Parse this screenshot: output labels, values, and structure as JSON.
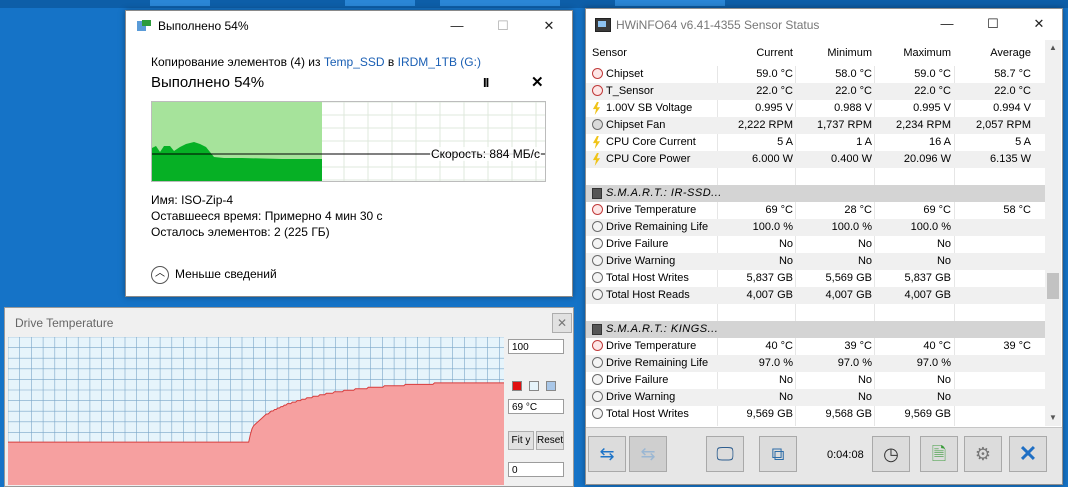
{
  "copy_dialog": {
    "title": "Выполнено 54%",
    "line_prefix": "Копирование элементов (4) из",
    "source": "Temp_SSD",
    "line_mid": "в",
    "target": "IRDM_1TB (G:)",
    "heading": "Выполнено 54%",
    "progress_percent": 54,
    "speed_label": "Скорость: 884 МБ/с",
    "name_label": "Имя:",
    "name_value": "ISO-Zip-4",
    "time_label": "Оставшееся время:",
    "time_value": "Примерно 4 мин 30 с",
    "items_label": "Осталось элементов:",
    "items_value": "2 (225 ГБ)",
    "less_details": "Меньше сведений",
    "minimize": "—",
    "maximize": "☐",
    "close": "✕",
    "pause": "II",
    "cancel": "✕",
    "colors": {
      "fill": "#06b025",
      "fill_light": "#a6e39b"
    }
  },
  "temp_graph": {
    "title": "Drive Temperature",
    "close": "✕",
    "max_value": "100",
    "current_value": "69 °C",
    "min_value": "0",
    "fit_y": "Fit y",
    "reset": "Reset",
    "colors": {
      "area": "#f6a0a0",
      "line": "#d83c3c",
      "grid": "#7aa6c8",
      "bg": "#e6f4fb",
      "swatch_red": "#e01010",
      "swatch_light": "#e6f4fb",
      "swatch_blue": "#a9c7e8"
    },
    "series_y": [
      29,
      29,
      29,
      29,
      29,
      29,
      29,
      29,
      29,
      29,
      29,
      29,
      29,
      29,
      29,
      29,
      29,
      29,
      29,
      29,
      29,
      29,
      29,
      29,
      29,
      29,
      29,
      29,
      29,
      29,
      29,
      29,
      29,
      29,
      29,
      29,
      29,
      29,
      29,
      29,
      29,
      29,
      29,
      29,
      29,
      29,
      29,
      29,
      29,
      29,
      29,
      29,
      29,
      29,
      29,
      29,
      29,
      29,
      29,
      29,
      29,
      29,
      29,
      29,
      29,
      29,
      29,
      29,
      29,
      29,
      29,
      29,
      29,
      29,
      29,
      29,
      29,
      29,
      29,
      29,
      29,
      29,
      29,
      29,
      29,
      29,
      29,
      29,
      29,
      29,
      29,
      29,
      29,
      29,
      29,
      29,
      29,
      29,
      29,
      29,
      29,
      29,
      29,
      29,
      29,
      29,
      29,
      29,
      29,
      29,
      29,
      29,
      29,
      29,
      29,
      29,
      29,
      29,
      29,
      29,
      29,
      29,
      29,
      29,
      29,
      29,
      29,
      29,
      29,
      29,
      29,
      29,
      29,
      29,
      29,
      29,
      29,
      29,
      29,
      29,
      29,
      29,
      29,
      29,
      29,
      29,
      29,
      29,
      29,
      29,
      34,
      38,
      40,
      41,
      42,
      43,
      44,
      45,
      46,
      47,
      48,
      48,
      49,
      50,
      50,
      51,
      51,
      52,
      52,
      53,
      53,
      54,
      54,
      55,
      55,
      55,
      56,
      56,
      56,
      57,
      57,
      57,
      58,
      58,
      58,
      59,
      59,
      59,
      59,
      60,
      60,
      60,
      60,
      61,
      61,
      61,
      61,
      62,
      62,
      62,
      62,
      62,
      63,
      63,
      63,
      63,
      63,
      63,
      64,
      64,
      64,
      64,
      64,
      64,
      64,
      65,
      65,
      65,
      65,
      65,
      65,
      65,
      65,
      66,
      66,
      66,
      66,
      66,
      66,
      66,
      66,
      66,
      66,
      67,
      67,
      67,
      67,
      67,
      67,
      67,
      67,
      67,
      67,
      67,
      67,
      67,
      68,
      68,
      68,
      68,
      68,
      68,
      68,
      68,
      68,
      68,
      68,
      68,
      68,
      68,
      68,
      68,
      68,
      68,
      69,
      69,
      69,
      69,
      69,
      69,
      69,
      69,
      69,
      69,
      69,
      69,
      69,
      69,
      69,
      69,
      69,
      69,
      69,
      69,
      69,
      69,
      69,
      69,
      69,
      69,
      69,
      69,
      69,
      69,
      69,
      69,
      69,
      69,
      69,
      69,
      69,
      69,
      69,
      69,
      69,
      69,
      69,
      69
    ]
  },
  "hwinfo": {
    "title": "HWiNFO64 v6.41-4355 Sensor Status",
    "minimize": "—",
    "maximize": "☐",
    "close": "✕",
    "headers": [
      "Sensor",
      "Current",
      "Minimum",
      "Maximum",
      "Average"
    ],
    "rows": [
      {
        "type": "row",
        "icon": "thermometer-icon",
        "name": "Chipset",
        "cur": "59.0 °C",
        "min": "58.0 °C",
        "max": "59.0 °C",
        "avg": "58.7 °C"
      },
      {
        "type": "row",
        "icon": "thermometer-icon",
        "name": "T_Sensor",
        "cur": "22.0 °C",
        "min": "22.0 °C",
        "max": "22.0 °C",
        "avg": "22.0 °C"
      },
      {
        "type": "row",
        "icon": "voltage-bolt-icon",
        "name": "1.00V SB Voltage",
        "cur": "0.995 V",
        "min": "0.988 V",
        "max": "0.995 V",
        "avg": "0.994 V"
      },
      {
        "type": "row",
        "icon": "fan-icon",
        "name": "Chipset Fan",
        "cur": "2,222 RPM",
        "min": "1,737 RPM",
        "max": "2,234 RPM",
        "avg": "2,057 RPM"
      },
      {
        "type": "row",
        "icon": "voltage-bolt-icon",
        "name": "CPU Core Current",
        "cur": "5 A",
        "min": "1 A",
        "max": "16 A",
        "avg": "5 A"
      },
      {
        "type": "row",
        "icon": "voltage-bolt-icon",
        "name": "CPU Core Power",
        "cur": "6.000 W",
        "min": "0.400 W",
        "max": "20.096 W",
        "avg": "6.135 W"
      },
      {
        "type": "blank"
      },
      {
        "type": "group",
        "icon": "drive-icon",
        "name": "S.M.A.R.T.: IR-SSD..."
      },
      {
        "type": "row",
        "icon": "thermometer-icon",
        "name": "Drive Temperature",
        "cur": "69 °C",
        "min": "28 °C",
        "max": "69 °C",
        "avg": "58 °C"
      },
      {
        "type": "row",
        "icon": "clock-icon",
        "name": "Drive Remaining Life",
        "cur": "100.0 %",
        "min": "100.0 %",
        "max": "100.0 %",
        "avg": ""
      },
      {
        "type": "row",
        "icon": "clock-icon",
        "name": "Drive Failure",
        "cur": "No",
        "min": "No",
        "max": "No",
        "avg": ""
      },
      {
        "type": "row",
        "icon": "clock-icon",
        "name": "Drive Warning",
        "cur": "No",
        "min": "No",
        "max": "No",
        "avg": ""
      },
      {
        "type": "row",
        "icon": "clock-icon",
        "name": "Total Host Writes",
        "cur": "5,837 GB",
        "min": "5,569 GB",
        "max": "5,837 GB",
        "avg": ""
      },
      {
        "type": "row",
        "icon": "clock-icon",
        "name": "Total Host Reads",
        "cur": "4,007 GB",
        "min": "4,007 GB",
        "max": "4,007 GB",
        "avg": ""
      },
      {
        "type": "blank"
      },
      {
        "type": "group",
        "icon": "drive-icon",
        "name": "S.M.A.R.T.: KINGS..."
      },
      {
        "type": "row",
        "icon": "thermometer-icon",
        "name": "Drive Temperature",
        "cur": "40 °C",
        "min": "39 °C",
        "max": "40 °C",
        "avg": "39 °C"
      },
      {
        "type": "row",
        "icon": "clock-icon",
        "name": "Drive Remaining Life",
        "cur": "97.0 %",
        "min": "97.0 %",
        "max": "97.0 %",
        "avg": ""
      },
      {
        "type": "row",
        "icon": "clock-icon",
        "name": "Drive Failure",
        "cur": "No",
        "min": "No",
        "max": "No",
        "avg": ""
      },
      {
        "type": "row",
        "icon": "clock-icon",
        "name": "Drive Warning",
        "cur": "No",
        "min": "No",
        "max": "No",
        "avg": ""
      },
      {
        "type": "row",
        "icon": "clock-icon",
        "name": "Total Host Writes",
        "cur": "9,569 GB",
        "min": "9,568 GB",
        "max": "9,569 GB",
        "avg": ""
      }
    ],
    "elapsed": "0:04:08",
    "toolbar_icons": [
      "nav-arrows-icon",
      "nav-arrows-disabled-icon",
      "monitor-search-icon",
      "network-icon",
      "clock-icon",
      "add-report-icon",
      "settings-gear-icon",
      "close-x-icon"
    ]
  }
}
